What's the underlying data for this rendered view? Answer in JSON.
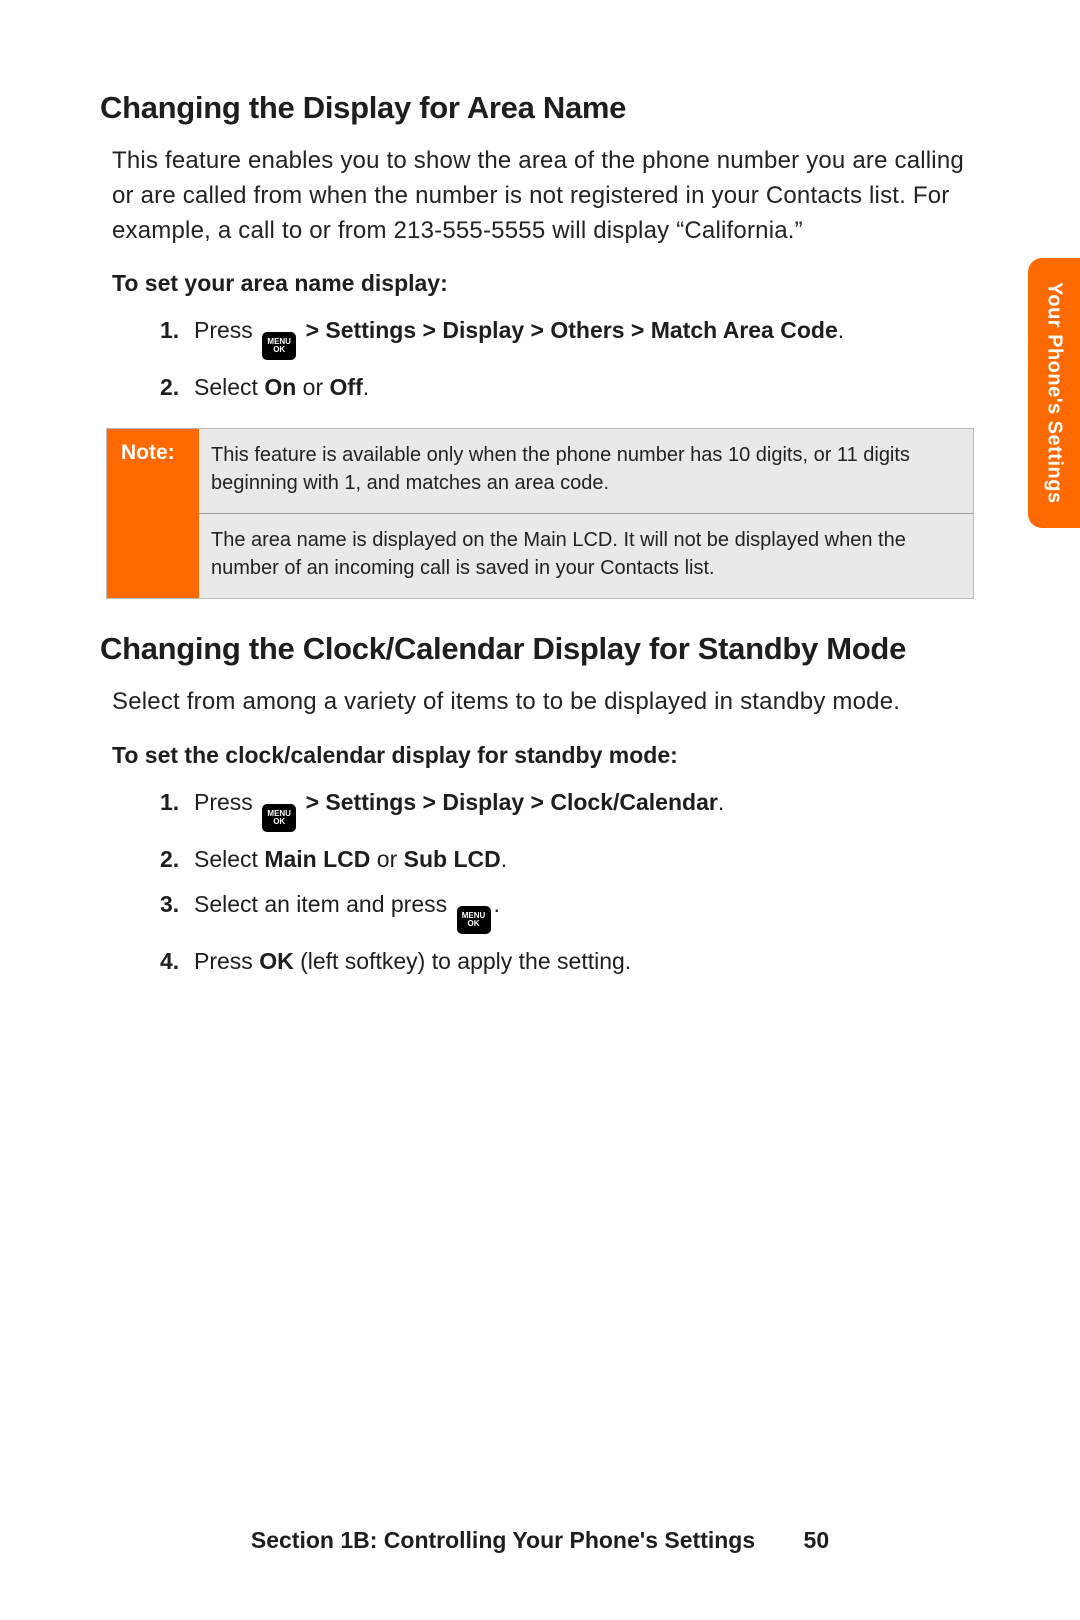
{
  "colors": {
    "accent": "#ff6a00"
  },
  "sideTab": {
    "label": "Your Phone's Settings"
  },
  "section1": {
    "heading": "Changing the Display for Area Name",
    "intro": "This feature enables you to show the area of the phone number you are calling or are called from when the number is not registered in your Contacts list. For example, a call to or from 213-555-5555 will display “California.”",
    "subhead": "To set your area name display:",
    "steps": [
      {
        "num": "1.",
        "pre": "Press ",
        "icon": "menu-ok",
        "post": " > Settings > Display > Others > Match Area Code",
        "trail": "."
      },
      {
        "num": "2.",
        "pre": "Select ",
        "bold1": "On",
        "mid": " or ",
        "bold2": "Off",
        "trail": "."
      }
    ],
    "note": {
      "label": "Note:",
      "rows": [
        "This feature is available only when the phone number has 10 digits, or 11 digits beginning with 1, and matches an area code.",
        "The area name is displayed on the Main LCD. It will not be displayed when the number of an incoming call is saved in your Contacts list."
      ]
    }
  },
  "section2": {
    "heading": "Changing the Clock/Calendar Display for Standby Mode",
    "intro": "Select from among a variety of items to to be displayed in standby mode.",
    "subhead": "To set the clock/calendar display for standby mode:",
    "steps": [
      {
        "num": "1.",
        "pre": "Press ",
        "icon": "menu-ok",
        "post": " > Settings > Display > Clock/Calendar",
        "trail": "."
      },
      {
        "num": "2.",
        "pre": "Select ",
        "bold1": "Main LCD",
        "mid": " or ",
        "bold2": "Sub LCD",
        "trail": "."
      },
      {
        "num": "3.",
        "pre": "Select an item and press ",
        "icon": "menu-ok",
        "trail": "."
      },
      {
        "num": "4.",
        "pre": "Press ",
        "bold1": "OK",
        "mid": " (left softkey) to apply the setting."
      }
    ]
  },
  "footer": {
    "section": "Section 1B: Controlling Your Phone's Settings",
    "page": "50"
  },
  "menuIcon": {
    "line1": "MENU",
    "line2": "OK"
  }
}
